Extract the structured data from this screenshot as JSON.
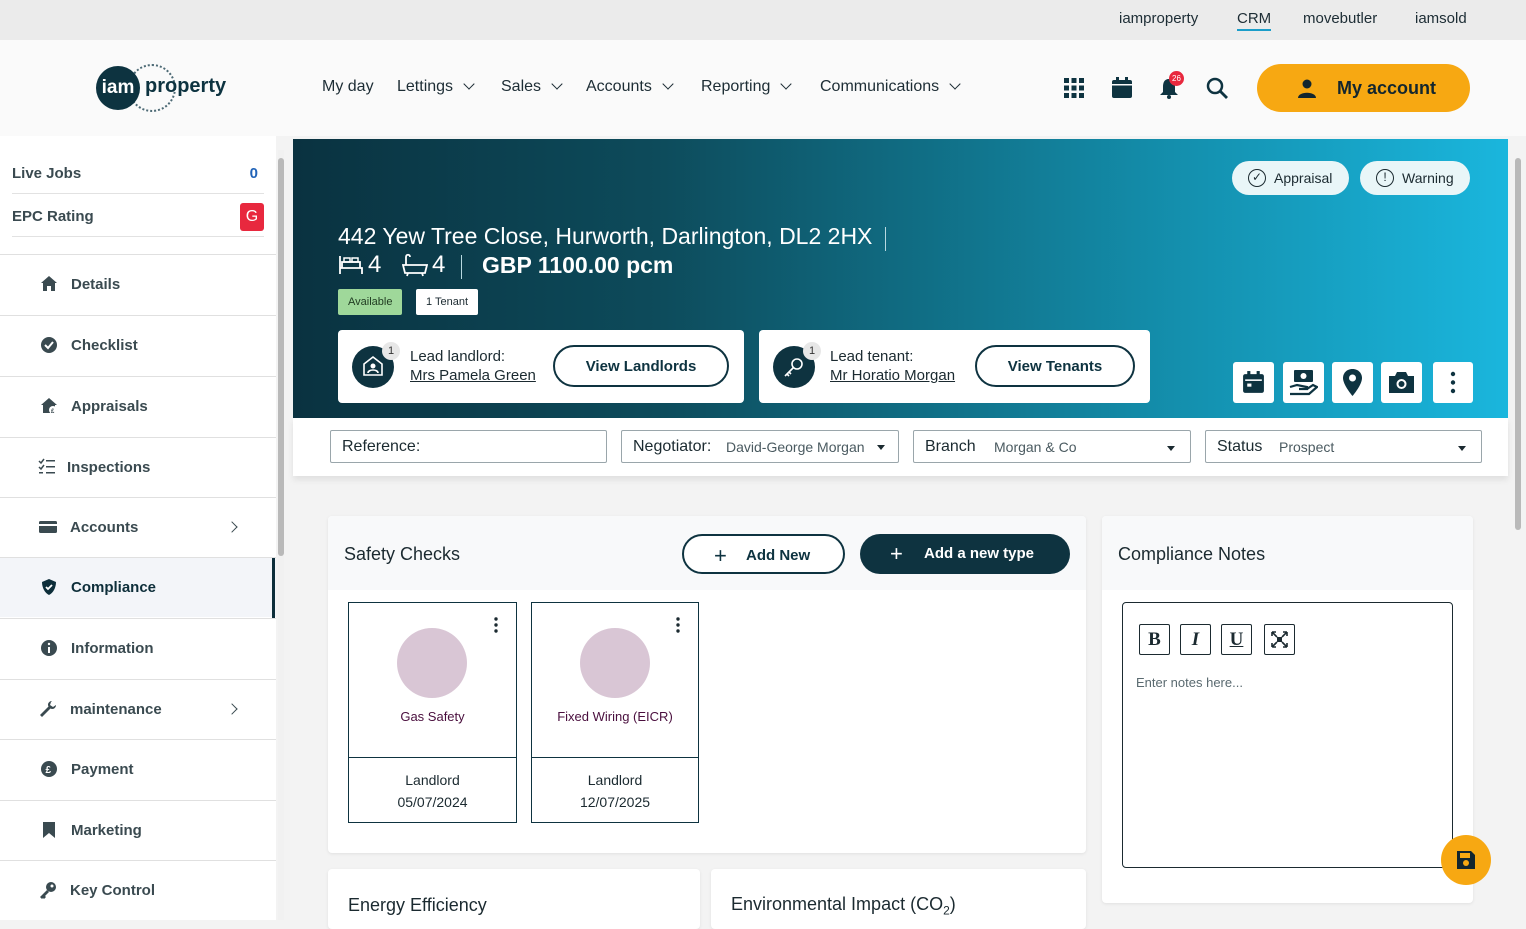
{
  "topbar": {
    "links": [
      "iamproperty",
      "CRM",
      "movebutler",
      "iamsold"
    ],
    "active": "CRM"
  },
  "header": {
    "logo": {
      "mark": "iam",
      "word": "property"
    },
    "nav": [
      "My day",
      "Lettings",
      "Sales",
      "Accounts",
      "Reporting",
      "Communications"
    ],
    "icons": [
      "apps-grid-icon",
      "calendar-icon",
      "bell-icon",
      "search-icon"
    ],
    "notification_count": "26",
    "account_label": "My account",
    "colors": {
      "accent": "#f7a812",
      "brand": "#0e3340"
    }
  },
  "sidebar": {
    "stats": [
      {
        "label": "Live Jobs",
        "value": "0"
      },
      {
        "label": "EPC Rating",
        "value": "G"
      }
    ],
    "items": [
      {
        "label": "Details",
        "icon": "home-icon"
      },
      {
        "label": "Checklist",
        "icon": "check-circle-icon"
      },
      {
        "label": "Appraisals",
        "icon": "house-pound-icon"
      },
      {
        "label": "Inspections",
        "icon": "list-check-icon"
      },
      {
        "label": "Accounts",
        "icon": "card-icon"
      },
      {
        "label": "Compliance",
        "icon": "shield-icon"
      },
      {
        "label": "Information",
        "icon": "info-icon"
      },
      {
        "label": "maintenance",
        "icon": "wrench-icon"
      },
      {
        "label": "Payment",
        "icon": "pound-icon"
      },
      {
        "label": "Marketing",
        "icon": "bookmark-icon"
      },
      {
        "label": "Key Control",
        "icon": "key-icon"
      }
    ],
    "active": "Compliance"
  },
  "property": {
    "address": "442 Yew Tree Close, Hurworth, Darlington, DL2 2HX",
    "bedrooms": "4",
    "bathrooms": "4",
    "price": "GBP 1100.00 pcm",
    "status_pill": "Available",
    "tenant_pill": "1 Tenant",
    "tags": [
      "Appraisal",
      "Warning"
    ],
    "lead_landlord": {
      "label": "Lead landlord:",
      "name": "Mrs Pamela Green",
      "count": "1",
      "button": "View Landlords"
    },
    "lead_tenant": {
      "label": "Lead tenant:",
      "name": "Mr Horatio Morgan",
      "count": "1",
      "button": "View Tenants"
    },
    "actions": [
      "calendar-icon",
      "money-hand-icon",
      "map-pin-icon",
      "camera-icon",
      "more-vertical-icon"
    ]
  },
  "filters": {
    "reference_label": "Reference:",
    "reference_value": "",
    "negotiator_label": "Negotiator:",
    "negotiator_value": "David-George Morgan",
    "branch_label": "Branch",
    "branch_value": "Morgan & Co",
    "status_label": "Status",
    "status_value": "Prospect"
  },
  "safety_checks": {
    "title": "Safety Checks",
    "add_new": "Add New",
    "add_type": "Add a new type",
    "tiles": [
      {
        "name": "Gas Safety",
        "who": "Landlord",
        "date": "05/07/2024"
      },
      {
        "name": "Fixed Wiring (EICR)",
        "who": "Landlord",
        "date": "12/07/2025"
      }
    ]
  },
  "compliance_notes": {
    "title": "Compliance Notes",
    "toolbar": [
      "B",
      "I",
      "U"
    ],
    "placeholder": "Enter notes here..."
  },
  "lower_cards": {
    "energy": "Energy Efficiency",
    "environmental": "Environmental Impact (CO",
    "environmental_sub": "2",
    "environmental_close": ")"
  }
}
